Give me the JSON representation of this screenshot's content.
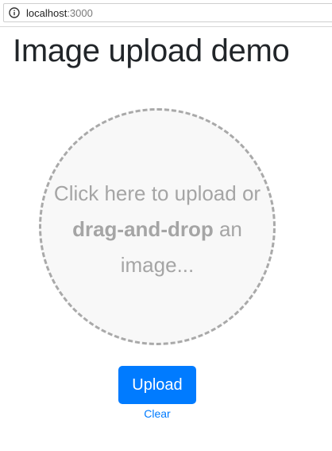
{
  "browser": {
    "url_host": "localhost",
    "url_port": ":3000",
    "info_icon": "info-circle-icon"
  },
  "page": {
    "title": "Image upload demo"
  },
  "dropzone": {
    "text_before": "Click here to upload or ",
    "text_bold": "drag-and-drop",
    "text_after": " an image...",
    "border_color": "#a9a9a9",
    "background_color": "#f8f8f8",
    "text_color": "#a5a5a5"
  },
  "actions": {
    "upload_label": "Upload",
    "clear_label": "Clear",
    "accent_color": "#007bff"
  }
}
